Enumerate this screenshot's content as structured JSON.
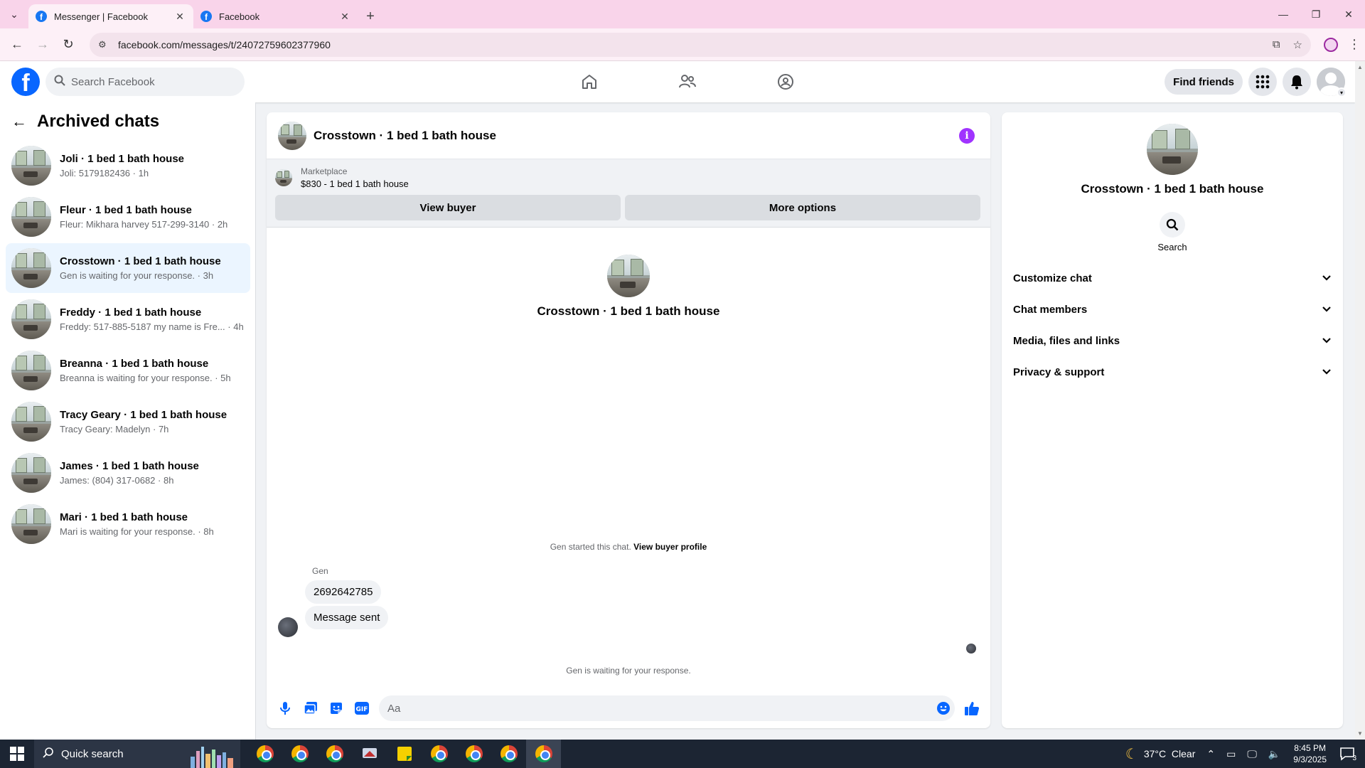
{
  "browser": {
    "tabs": [
      {
        "title": "Messenger | Facebook",
        "active": true
      },
      {
        "title": "Facebook",
        "active": false
      }
    ],
    "url": "facebook.com/messages/t/24072759602377960"
  },
  "fb_header": {
    "logo": "f",
    "search_placeholder": "Search Facebook",
    "find_friends": "Find friends"
  },
  "left_panel": {
    "title": "Archived chats",
    "chats": [
      {
        "name": "Joli · 1 bed 1 bath house",
        "preview": "Joli: 5179182436 · 1h"
      },
      {
        "name": "Fleur · 1 bed 1 bath house",
        "preview": "Fleur: Mikhara harvey 517-299-3140 · 2h"
      },
      {
        "name": "Crosstown · 1 bed 1 bath house",
        "preview": "Gen is waiting for your response. · 3h",
        "selected": true
      },
      {
        "name": "Freddy · 1 bed 1 bath house",
        "preview": "Freddy: 517-885-5187 my name is Fre... · 4h"
      },
      {
        "name": "Breanna · 1 bed 1 bath house",
        "preview": "Breanna is waiting for your response. · 5h"
      },
      {
        "name": "Tracy Geary · 1 bed 1 bath house",
        "preview": "Tracy Geary: Madelyn · 7h"
      },
      {
        "name": "James · 1 bed 1 bath house",
        "preview": "James: (804) 317-0682 · 8h"
      },
      {
        "name": "Mari · 1 bed 1 bath house",
        "preview": "Mari is waiting for your response. · 8h"
      }
    ]
  },
  "conversation": {
    "title": "Crosstown · 1 bed 1 bath house",
    "marketplace": {
      "label": "Marketplace",
      "listing": "$830 - 1 bed 1 bath house",
      "view_buyer": "View buyer",
      "more_options": "More options"
    },
    "intro_name": "Crosstown · 1 bed 1 bath house",
    "started_text": "Gen started this chat.",
    "view_buyer_profile": "View buyer profile",
    "sender": "Gen",
    "messages": [
      "2692642785",
      "Message sent"
    ],
    "waiting_text": "Gen is waiting for your response.",
    "composer_placeholder": "Aa"
  },
  "details": {
    "name": "Crosstown · 1 bed 1 bath house",
    "search_label": "Search",
    "sections": [
      "Customize chat",
      "Chat members",
      "Media, files and links",
      "Privacy & support"
    ]
  },
  "taskbar": {
    "search_label": "Quick search",
    "weather": "37°C  Clear",
    "time": "8:45 PM",
    "date": "9/3/2025",
    "notification_count": "3"
  },
  "colors": {
    "fb_blue": "#0866ff",
    "selected_chat_bg": "#ebf5ff",
    "info_purple": "#a033ff",
    "tabbar_pink": "#f9d4ea"
  }
}
